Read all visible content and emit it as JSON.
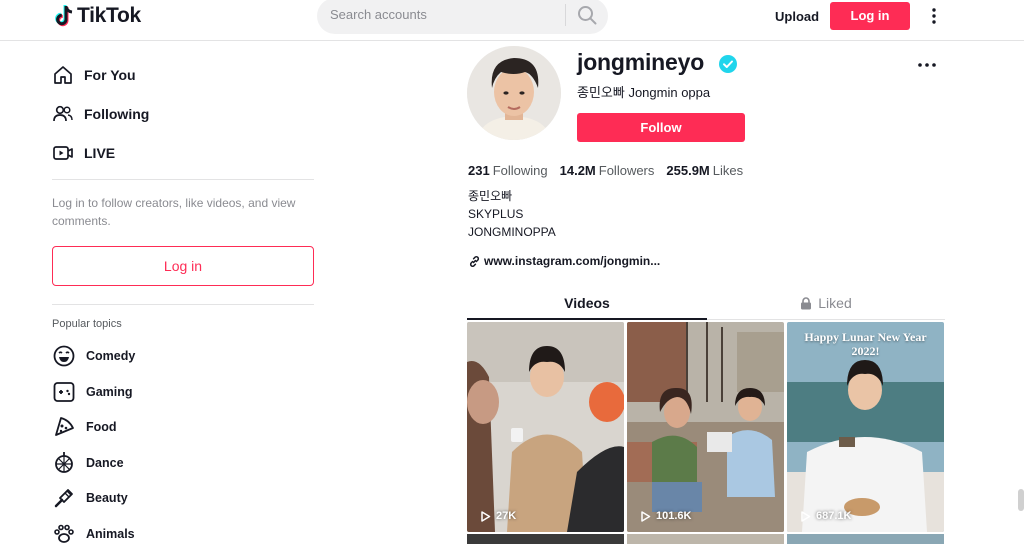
{
  "header": {
    "logo_text": "TikTok",
    "search_placeholder": "Search accounts",
    "upload_label": "Upload",
    "login_label": "Log in"
  },
  "sidebar": {
    "nav": [
      {
        "label": "For You",
        "icon": "home-icon"
      },
      {
        "label": "Following",
        "icon": "users-icon"
      },
      {
        "label": "LIVE",
        "icon": "live-icon"
      }
    ],
    "login_hint": "Log in to follow creators, like videos, and view comments.",
    "login_button": "Log in",
    "topics_title": "Popular topics",
    "topics": [
      {
        "label": "Comedy",
        "icon": "comedy-icon"
      },
      {
        "label": "Gaming",
        "icon": "gaming-icon"
      },
      {
        "label": "Food",
        "icon": "food-icon"
      },
      {
        "label": "Dance",
        "icon": "dance-icon"
      },
      {
        "label": "Beauty",
        "icon": "beauty-icon"
      },
      {
        "label": "Animals",
        "icon": "animals-icon"
      }
    ]
  },
  "profile": {
    "username": "jongmineyo",
    "nickname": "종민오빠 Jongmin oppa",
    "follow_label": "Follow",
    "stats": [
      {
        "num": "231",
        "label": "Following"
      },
      {
        "num": "14.2M",
        "label": "Followers"
      },
      {
        "num": "255.9M",
        "label": "Likes"
      }
    ],
    "bio": [
      "종민오빠",
      "SKYPLUS",
      "JONGMINOPPA"
    ],
    "link": "www.instagram.com/jongmin..."
  },
  "tabs": {
    "videos": "Videos",
    "liked": "Liked"
  },
  "videos": [
    {
      "views": "27K",
      "caption": ""
    },
    {
      "views": "101.6K",
      "caption": ""
    },
    {
      "views": "687.1K",
      "caption": "Happy Lunar New Year 2022!"
    }
  ],
  "colors": {
    "accent": "#fe2c55",
    "verified": "#20d5ec"
  }
}
